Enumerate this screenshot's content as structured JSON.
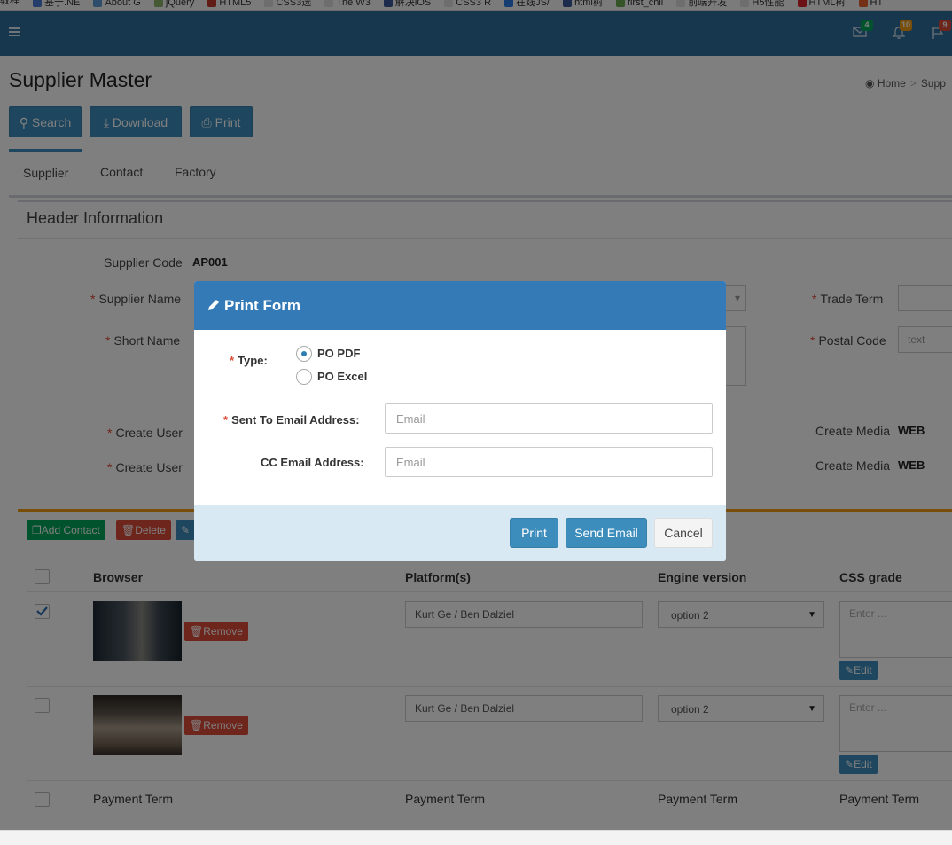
{
  "bookmarks": [
    "教程",
    "基于.NE",
    "About G",
    "jQuery",
    "HTML5",
    "CSS3选",
    "The W3",
    "解决iOS",
    "CSS3 R",
    "在线JS/",
    "html树",
    "first_chil",
    "前端开发",
    "H5性能",
    "HTML树",
    "HT"
  ],
  "header": {
    "mail_badge": "4",
    "bell_badge": "10",
    "flag_badge": "9",
    "mail_badge_color": "#00a65a",
    "bell_badge_color": "#f39c12",
    "flag_badge_color": "#dd4b39"
  },
  "page": {
    "title": "Supplier Master",
    "breadcrumb": [
      "Home",
      "Supp"
    ],
    "actions": {
      "search": "Search",
      "download": "Download",
      "print": "Print"
    },
    "tabs": [
      "Supplier",
      "Contact",
      "Factory"
    ],
    "section_title": "Header Information",
    "fields": {
      "supplier_code_label": "Supplier Code",
      "supplier_code_value": "AP001",
      "supplier_name_label": "Supplier Name",
      "short_name_label": "Short Name",
      "trade_term_label": "Trade Term",
      "postal_code_label": "Postal Code",
      "postal_code_placeholder": "text",
      "create_user_label_1": "Create User",
      "create_user_label_2": "Create User",
      "create_media_label_1": "Create Media",
      "create_media_value_1": "WEB",
      "create_media_label_2": "Create Media",
      "create_media_value_2": "WEB"
    },
    "contact_actions": {
      "add": "Add Contact",
      "delete": "Delete"
    },
    "grid": {
      "columns": [
        "Browser",
        "Platform(s)",
        "Engine version",
        "CSS grade"
      ],
      "rows": [
        {
          "checked": true,
          "remove": "Remove",
          "platform": "Kurt Ge / Ben Dalziel",
          "engine": "option 2",
          "css_placeholder": "Enter ...",
          "edit": "Edit"
        },
        {
          "checked": false,
          "remove": "Remove",
          "platform": "Kurt Ge / Ben Dalziel",
          "engine": "option 2",
          "css_placeholder": "Enter ...",
          "edit": "Edit"
        }
      ],
      "footer_row": [
        "Payment Term",
        "Payment Term",
        "Payment Term",
        "Payment Term"
      ]
    }
  },
  "modal": {
    "title": "Print Form",
    "type_label": "Type:",
    "type_options": [
      "PO PDF",
      "PO Excel"
    ],
    "type_selected": "PO PDF",
    "sent_to_label": "Sent To Email Address:",
    "sent_to_placeholder": "Email",
    "sent_to_value": "",
    "cc_label": "CC Email Address:",
    "cc_placeholder": "Email",
    "cc_value": "",
    "buttons": {
      "print": "Print",
      "send_email": "Send Email",
      "cancel": "Cancel"
    }
  }
}
